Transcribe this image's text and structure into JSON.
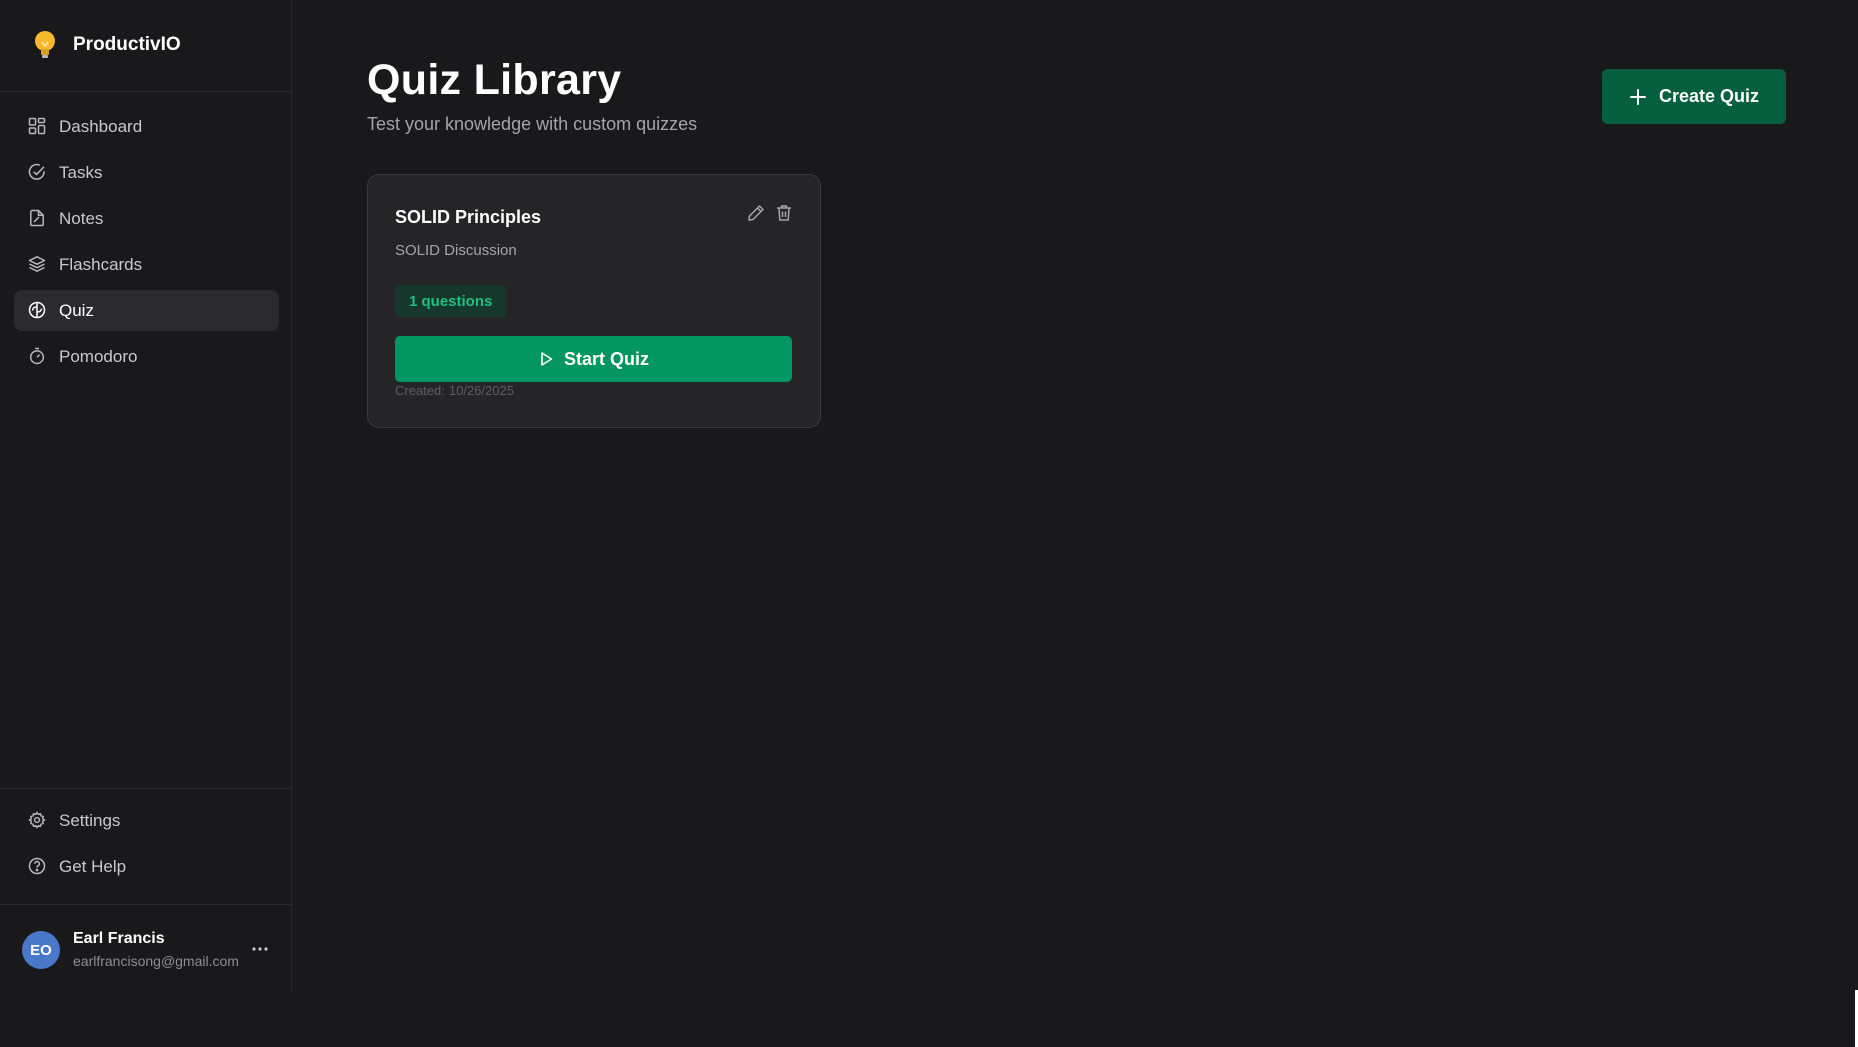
{
  "app": {
    "brand_name": "ProductivIO",
    "colors": {
      "background": "#19191b",
      "sidebar_active": "#2b2b2f",
      "primary_green": "#039562",
      "create_button": "#06603f",
      "badge_bg": "#16382c",
      "badge_text": "#1fbf7e",
      "avatar": "#4a78c9",
      "brand_icon": "#f5b82e"
    }
  },
  "sidebar": {
    "items": [
      {
        "label": "Dashboard",
        "icon": "dashboard-icon"
      },
      {
        "label": "Tasks",
        "icon": "check-circle-icon"
      },
      {
        "label": "Notes",
        "icon": "notes-icon"
      },
      {
        "label": "Flashcards",
        "icon": "layers-icon"
      },
      {
        "label": "Quiz",
        "icon": "brain-icon",
        "active": true
      },
      {
        "label": "Pomodoro",
        "icon": "timer-icon"
      }
    ],
    "bottom_items": [
      {
        "label": "Settings",
        "icon": "gear-icon"
      },
      {
        "label": "Get Help",
        "icon": "help-circle-icon"
      }
    ],
    "user": {
      "initials": "EO",
      "name": "Earl Francis",
      "email": "earlfrancisong@gmail.com"
    }
  },
  "main": {
    "title": "Quiz Library",
    "subtitle": "Test your knowledge with custom quizzes",
    "create_label": "Create Quiz",
    "quizzes": [
      {
        "title": "SOLID Principles",
        "description": "SOLID Discussion",
        "questions_badge": "1 questions",
        "start_label": "Start Quiz",
        "created_label": "Created:",
        "created_date": "10/26/2025"
      }
    ]
  }
}
